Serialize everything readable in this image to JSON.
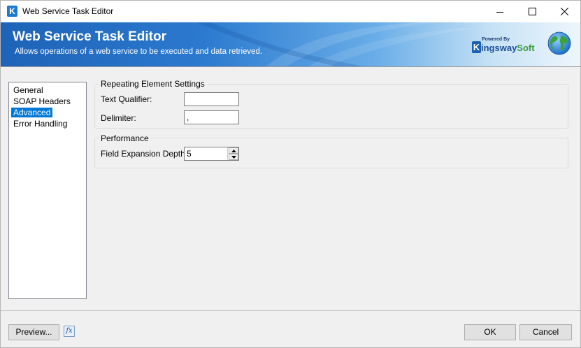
{
  "window": {
    "title": "Web Service Task Editor",
    "app_icon_letter": "K"
  },
  "banner": {
    "title": "Web Service Task Editor",
    "subtitle": "Allows operations of a web service to be executed and data retrieved.",
    "brand_powered": "Powered By",
    "brand_k": "K",
    "brand_name_main": "ingsway",
    "brand_name_accent": "Soft"
  },
  "nav": {
    "items": [
      {
        "label": "General"
      },
      {
        "label": "SOAP Headers"
      },
      {
        "label": "Advanced",
        "selected": true
      },
      {
        "label": "Error Handling"
      }
    ]
  },
  "repeating": {
    "legend": "Repeating Element Settings",
    "text_qualifier_label": "Text Qualifier:",
    "text_qualifier_value": "",
    "delimiter_label": "Delimiter:",
    "delimiter_value": ","
  },
  "performance": {
    "legend": "Performance",
    "depth_label": "Field Expansion Depth:",
    "depth_value": "5"
  },
  "footer": {
    "preview_label": "Preview...",
    "fx_label": "fx",
    "ok_label": "OK",
    "cancel_label": "Cancel"
  },
  "colors": {
    "selection": "#0078d7",
    "banner_start": "#1e63b8",
    "banner_end": "#eef6fc"
  }
}
